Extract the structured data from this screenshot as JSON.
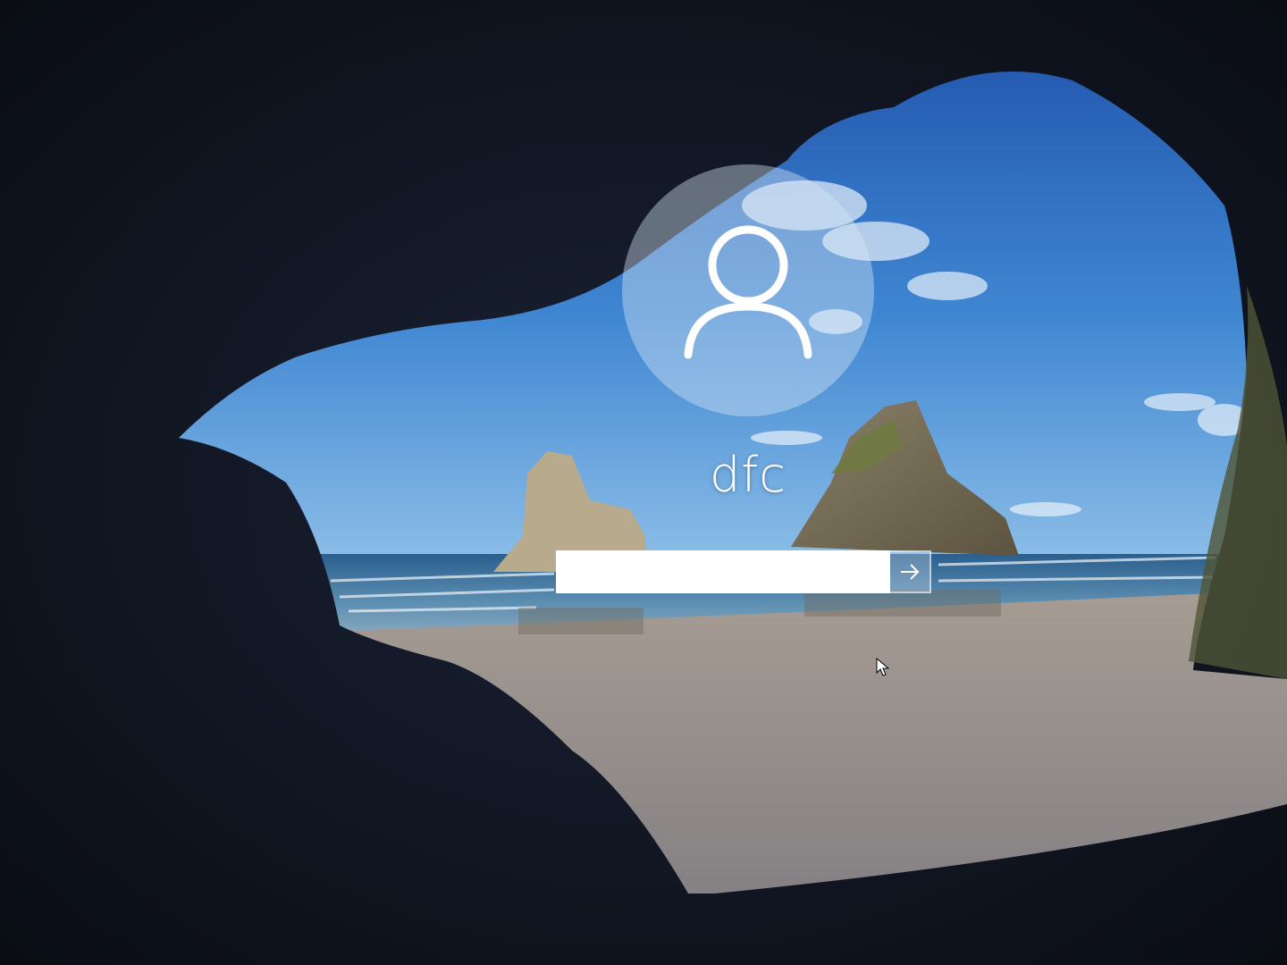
{
  "login": {
    "username": "dfc",
    "password_placeholder": "",
    "password_value": ""
  },
  "icons": {
    "avatar": "user-silhouette-icon",
    "submit": "arrow-right-icon",
    "cursor": "mouse-pointer-icon"
  },
  "colors": {
    "avatar_circle": "#d7e6f5",
    "text": "#ffffff",
    "field_background": "#ffffff"
  }
}
